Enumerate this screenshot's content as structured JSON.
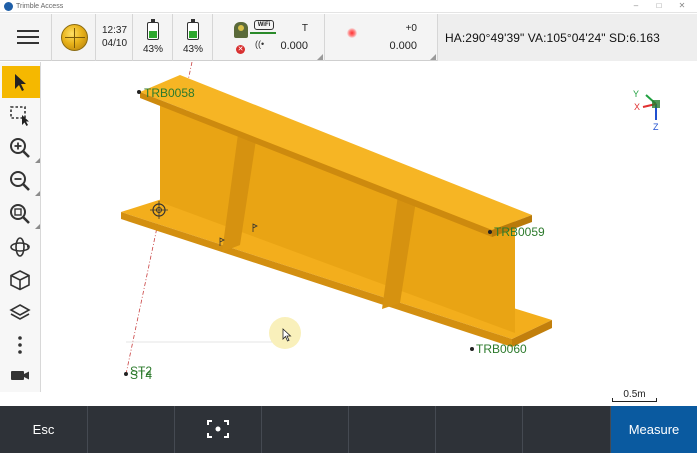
{
  "window": {
    "title": "Trimble Access",
    "minimize": "–",
    "maximize": "□",
    "close": "✕"
  },
  "status": {
    "time": "12:37",
    "date": "04/10",
    "battery1_pct": "43%",
    "battery2_pct": "43%",
    "battery_level": 0.43,
    "wifi_label": "WiFi",
    "height_label": "T",
    "height_value": "0.000",
    "prism_offset_label": "+0",
    "prism_offset_value": "0.000",
    "angles_text": "HA:290°49'39\"  VA:105°04'24\"  SD:6.163"
  },
  "toolbar": {
    "tools": [
      {
        "name": "select-tool",
        "icon": "pointer-icon",
        "active": true
      },
      {
        "name": "box-select-tool",
        "icon": "box-select-icon",
        "active": false
      },
      {
        "name": "zoom-in-tool",
        "icon": "zoom-in-icon",
        "active": false
      },
      {
        "name": "zoom-out-tool",
        "icon": "zoom-out-icon",
        "active": false
      },
      {
        "name": "zoom-extents-tool",
        "icon": "zoom-extents-icon",
        "active": false
      },
      {
        "name": "orbit-tool",
        "icon": "orbit-icon",
        "active": false
      },
      {
        "name": "view-cube-tool",
        "icon": "cube-icon",
        "active": false
      },
      {
        "name": "layers-tool",
        "icon": "layers-icon",
        "active": false
      },
      {
        "name": "more-tool",
        "icon": "more-vertical-icon",
        "active": false
      },
      {
        "name": "camera-tool",
        "icon": "video-camera-icon",
        "active": false
      }
    ]
  },
  "viewport": {
    "points": {
      "trb0058": "TRB0058",
      "trb0059": "TRB0059",
      "trb0060": "TRB0060",
      "st2": "ST2",
      "st4": "ST4"
    },
    "axis_x": "X",
    "axis_y": "Y",
    "axis_z": "Z",
    "scale_label": "0.5m",
    "beam_color": "#f0a818"
  },
  "bottom": {
    "esc_label": "Esc",
    "measure_label": "Measure"
  }
}
